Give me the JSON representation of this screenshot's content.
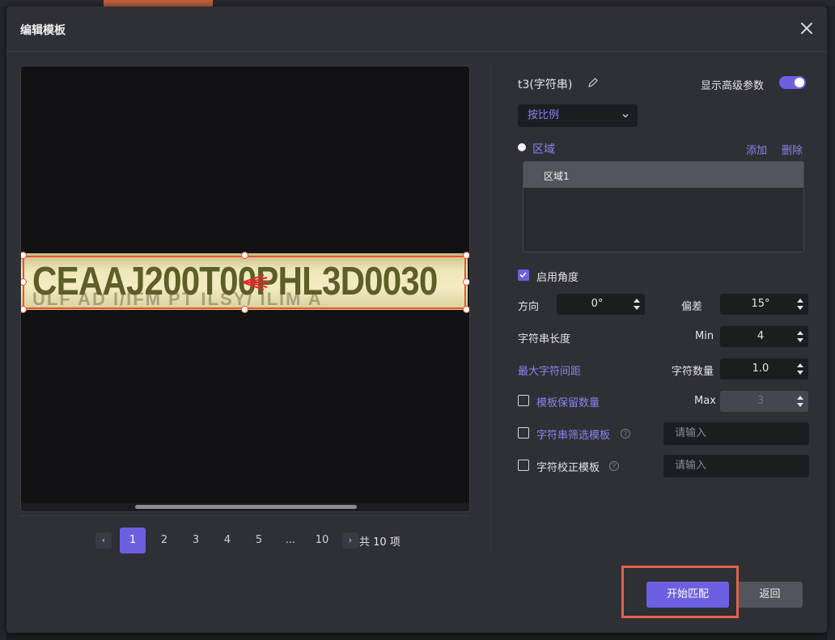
{
  "dialog": {
    "title": "编辑模板"
  },
  "image": {
    "plate_text": "CEAAJ200T00PHL3D0030",
    "plate_ghost_text": "ULF AD I/IFM PT ILSY/ ILIM A"
  },
  "pagination": {
    "pages": [
      "1",
      "2",
      "3",
      "4",
      "5",
      "...",
      "10"
    ],
    "current": "1",
    "total_label": "共 10 项"
  },
  "panel": {
    "template_name": "t3(字符串)",
    "advanced_label": "显示高级参数",
    "advanced_on": true,
    "scale_mode": "按比例",
    "region_section": "区域",
    "add_label": "添加",
    "delete_label": "删除",
    "regions": [
      "区域1"
    ],
    "enable_angle_label": "启用角度",
    "enable_angle_checked": true,
    "direction_label": "方向",
    "direction_value": "0°",
    "deviation_label": "偏差",
    "deviation_value": "15°",
    "string_length_label": "字符串长度",
    "min_label": "Min",
    "min_value": "4",
    "max_spacing_label": "最大字符间距",
    "char_count_label": "字符数量",
    "char_count_value": "1.0",
    "keep_count_label": "模板保留数量",
    "max_label": "Max",
    "max_value": "3",
    "filter_template_label": "字符串筛选模板",
    "filter_placeholder": "请输入",
    "correct_template_label": "字符校正模板",
    "correct_placeholder": "请输入"
  },
  "buttons": {
    "start_match": "开始匹配",
    "back": "返回"
  },
  "colors": {
    "accent": "#6d60e0",
    "highlight": "#e2624a",
    "selection": "#f0502a"
  }
}
